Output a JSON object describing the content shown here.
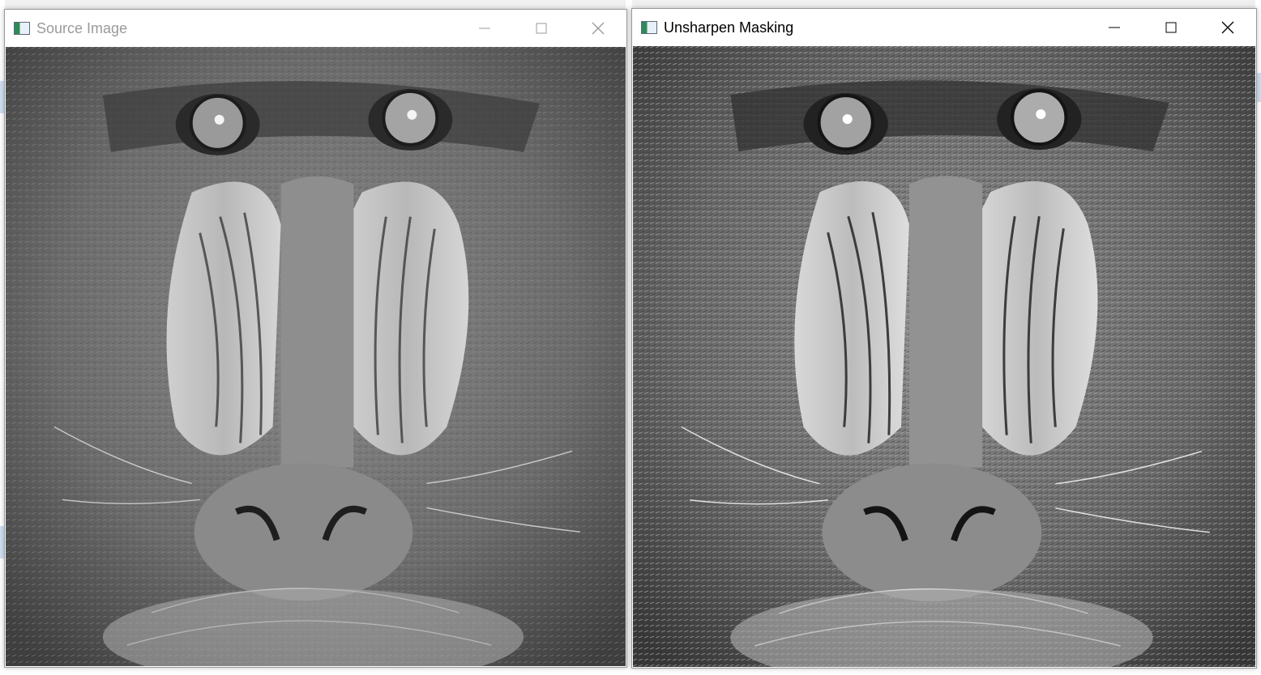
{
  "windows": {
    "source": {
      "title": "Source Image",
      "active": false
    },
    "unsharp": {
      "title": "Unsharpen Masking",
      "active": true
    }
  },
  "icons": {
    "app": "opencv-window-icon",
    "minimize": "minimize-icon",
    "maximize": "maximize-icon",
    "close": "close-icon"
  },
  "colors": {
    "inactive_title": "#9a9a9a",
    "active_title": "#000000"
  }
}
